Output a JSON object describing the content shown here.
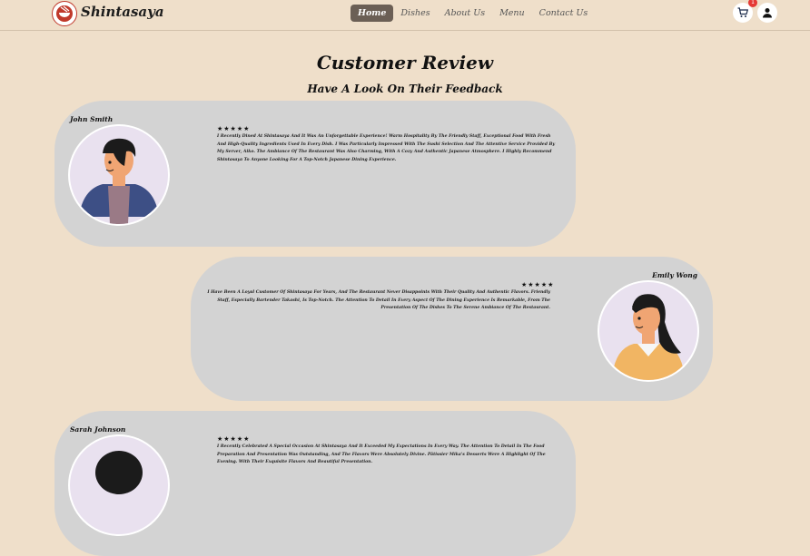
{
  "nav": {
    "brand": "Shintasaya",
    "items": [
      {
        "label": "Home",
        "active": true
      },
      {
        "label": "Dishes",
        "active": false
      },
      {
        "label": "About Us",
        "active": false
      },
      {
        "label": "Menu",
        "active": false
      },
      {
        "label": "Contact Us",
        "active": false
      }
    ],
    "cart_badge": "1",
    "icons": {
      "cart": "cart-icon",
      "user": "user-icon",
      "logo": "ramen-bowl-logo"
    }
  },
  "page": {
    "title": "Customer Review",
    "subtitle": "Have A Look On Their Feedback"
  },
  "reviews": [
    {
      "name": "John Smith",
      "stars": "★★★★★",
      "rating": 5,
      "text": "I Recently Dined At Shintasaya And It Was An Unforgettable Experience! Warm Hospitality By The Friendly Staff, Exceptional Food With Fresh And High-Quality Ingredients Used In Every Dish. I Was Particularly Impressed With The Sushi Selection And The Attentive Service Provided By My Server, Aiko. The Ambiance Of The Restaurant Was Also Charming, With A Cozy And Authentic Japanese Atmosphere. I Highly Recommend Shintasaya To Anyone Looking For A Top-Notch Japanese Dining Experience."
    },
    {
      "name": "Emily Wong",
      "stars": "★★★★★",
      "rating": 5,
      "text": "I Have Been A Loyal Customer Of Shintasaya For Years, And The Restaurant Never Disappoints With Their Quality And Authentic Flavors. Friendly Staff, Especially Bartender Takashi, Is Top-Notch. The Attention To Detail In Every Aspect Of The Dining Experience Is Remarkable, From The Presentation Of The Dishes To The Serene Ambiance Of The Restaurant."
    },
    {
      "name": "Sarah Johnson",
      "stars": "★★★★★",
      "rating": 5,
      "text": "I Recently Celebrated A Special Occasion At Shintasaya And It Exceeded My Expectations In Every Way. The Attention To Detail In The Food Preparation And Presentation Was Outstanding, And The Flavors Were Absolutely Divine. Pâtissier Mika's Desserts Were A Highlight Of The Evening. With Their Exquisite Flavors And Beautiful Presentation."
    }
  ]
}
